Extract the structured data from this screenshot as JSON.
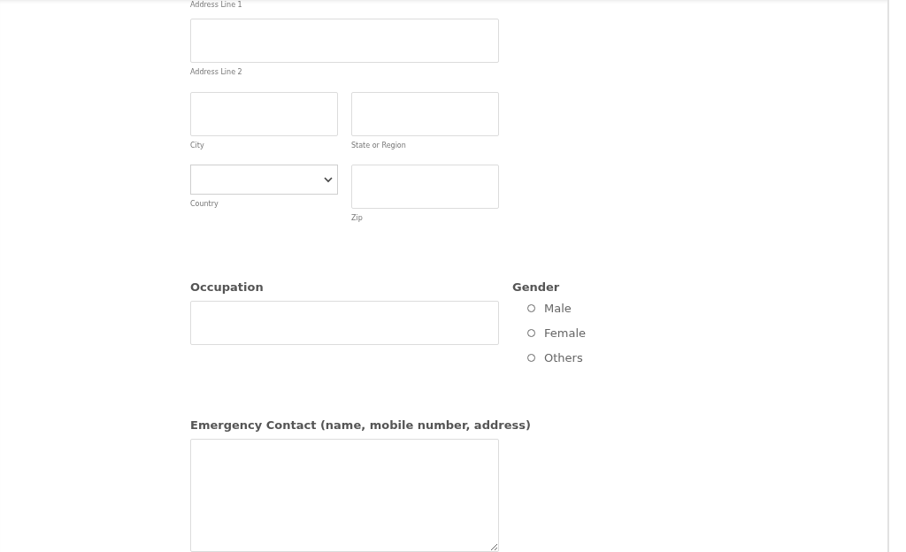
{
  "address": {
    "line1_caption": "Address Line 1",
    "line2_caption": "Address Line 2",
    "city_caption": "City",
    "state_caption": "State or Region",
    "country_caption": "Country",
    "zip_caption": "Zip"
  },
  "occupation": {
    "label": "Occupation"
  },
  "gender": {
    "label": "Gender",
    "options": [
      {
        "label": "Male",
        "selected": false
      },
      {
        "label": "Female",
        "selected": false
      },
      {
        "label": "Others",
        "selected": false
      }
    ]
  },
  "emergency_contact": {
    "label": "Emergency Contact (name, mobile number, address)"
  }
}
